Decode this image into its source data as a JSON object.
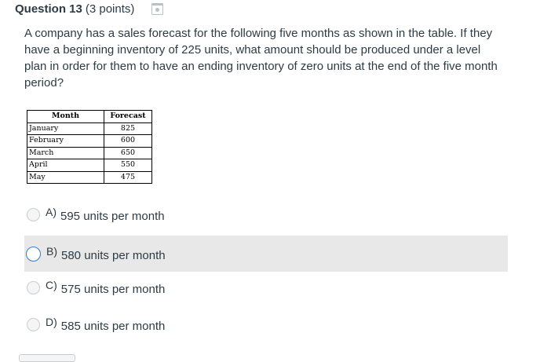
{
  "question": {
    "number": "Question 13",
    "points": "(3 points)",
    "text": "A company has a sales forecast for the following five months as shown in the table. If they have a beginning inventory of 225 units, what amount should be produced under a level plan in order for them to have an ending inventory of zero units at the end of the five month period?"
  },
  "table": {
    "headers": [
      "Month",
      "Forecast"
    ],
    "rows": [
      {
        "month": "January",
        "forecast": "825"
      },
      {
        "month": "February",
        "forecast": "600"
      },
      {
        "month": "March",
        "forecast": "650"
      },
      {
        "month": "April",
        "forecast": "550"
      },
      {
        "month": "May",
        "forecast": "475"
      }
    ]
  },
  "answers": [
    {
      "letter": "A)",
      "text": "595 units per month"
    },
    {
      "letter": "B)",
      "text": "580 units per month"
    },
    {
      "letter": "C)",
      "text": "575 units per month"
    },
    {
      "letter": "D)",
      "text": "585 units per month"
    }
  ],
  "icons": {
    "flag": "flag-question-icon"
  },
  "colors": {
    "hover_row": "#e8e8e8",
    "radio_focus": "#2d7bd8",
    "text": "#2d3b45"
  }
}
